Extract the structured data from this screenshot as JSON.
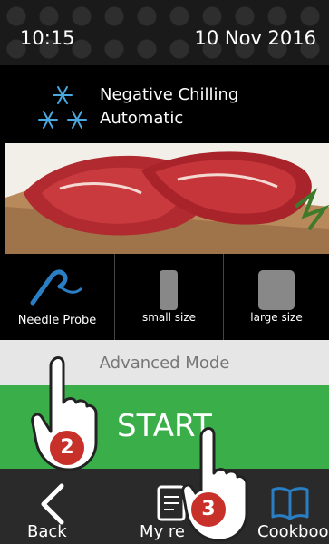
{
  "status_bar": {
    "time": "10:15",
    "date": "10 Nov 2016"
  },
  "mode": {
    "icon": "snowflake-icon",
    "line1": "Negative Chilling",
    "line2": "Automatic"
  },
  "options": [
    {
      "label": "Needle Probe",
      "icon": "needle-probe-icon"
    },
    {
      "label": "small size",
      "icon": "small-size-icon"
    },
    {
      "label": "large size",
      "icon": "large-size-icon"
    }
  ],
  "advanced_mode_label": "Advanced Mode",
  "start_label": "START",
  "nav": [
    {
      "label": "Back",
      "icon": "back-arrow-icon"
    },
    {
      "label": "My re",
      "icon": "recipes-icon"
    },
    {
      "label": "Cookbook",
      "icon": "book-icon"
    }
  ],
  "annotations": [
    {
      "number": "2"
    },
    {
      "number": "3"
    }
  ],
  "colors": {
    "start_green": "#3aae49",
    "probe_blue": "#2a7fc4",
    "badge_red": "#c8302a"
  }
}
